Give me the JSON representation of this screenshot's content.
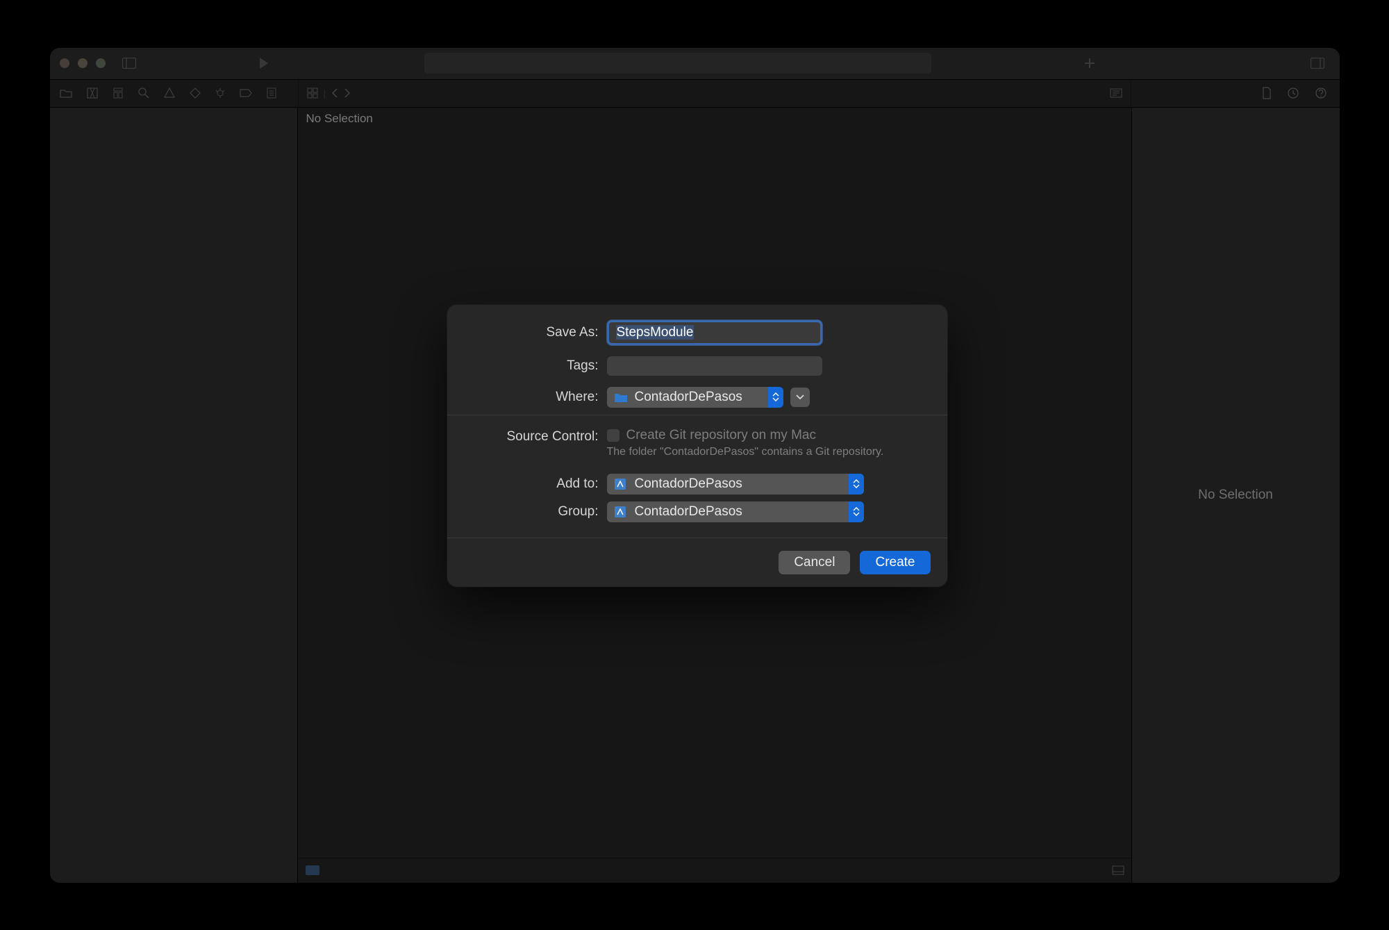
{
  "editor": {
    "no_selection": "No Selection"
  },
  "inspector": {
    "no_selection": "No Selection"
  },
  "dialog": {
    "save_as_label": "Save As:",
    "save_as_value": "StepsModule",
    "tags_label": "Tags:",
    "where_label": "Where:",
    "where_value": "ContadorDePasos",
    "source_control_label": "Source Control:",
    "create_git_label": "Create Git repository on my Mac",
    "git_hint": "The folder \"ContadorDePasos\" contains a Git repository.",
    "add_to_label": "Add to:",
    "add_to_value": "ContadorDePasos",
    "group_label": "Group:",
    "group_value": "ContadorDePasos",
    "cancel": "Cancel",
    "create": "Create"
  },
  "colors": {
    "accent": "#1468d8",
    "focus_ring": "#3869b0"
  }
}
